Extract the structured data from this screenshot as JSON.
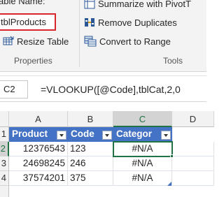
{
  "ribbon": {
    "table_name_label": "able Name:",
    "table_name_value": "tblProducts",
    "resize_table": "Resize Table",
    "properties_group": "Properties",
    "summarize_pivot": "Summarize with PivotT",
    "remove_duplicates": "Remove Duplicates",
    "convert_to_range": "Convert to Range",
    "tools_group": "Tools"
  },
  "formula_bar": {
    "cell_ref": "C2",
    "formula": "=VLOOKUP([@Code],tblCat,2,0"
  },
  "grid": {
    "columns": [
      "A",
      "B",
      "C",
      "D"
    ],
    "rows": [
      "1",
      "2",
      "3",
      "4"
    ],
    "headers": [
      "Product",
      "Code",
      "Categor"
    ],
    "data": [
      [
        "12376543",
        "123",
        "#N/A"
      ],
      [
        "24698245",
        "246",
        "#N/A"
      ],
      [
        "37574201",
        "375",
        "#N/A"
      ]
    ],
    "accent_color": "#217346",
    "table_header_color": "#4472c4"
  }
}
